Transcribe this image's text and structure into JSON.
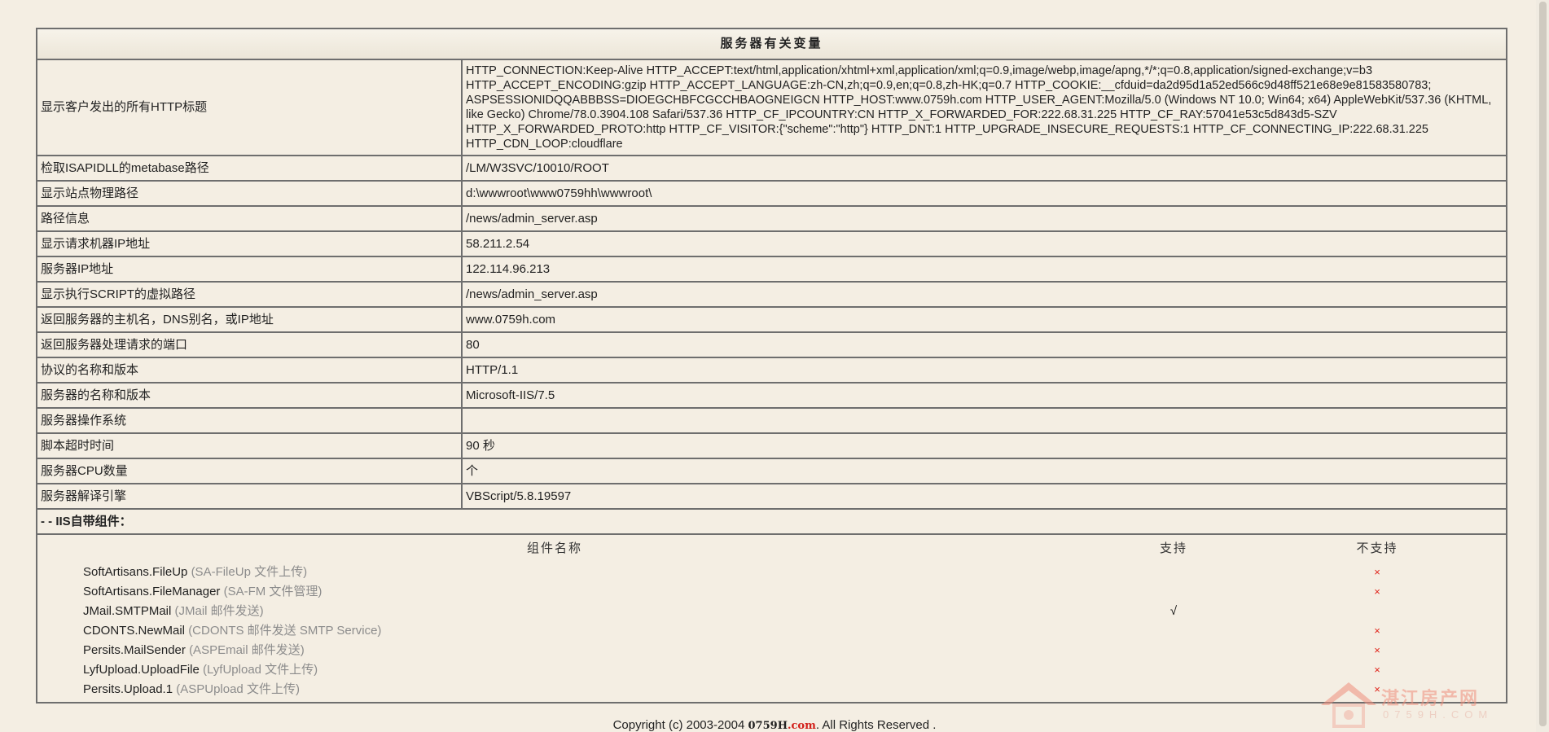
{
  "title": "服务器有关变量",
  "rows": [
    {
      "label": "显示客户发出的所有HTTP标题",
      "value": "HTTP_CONNECTION:Keep-Alive HTTP_ACCEPT:text/html,application/xhtml+xml,application/xml;q=0.9,image/webp,image/apng,*/*;q=0.8,application/signed-exchange;v=b3 HTTP_ACCEPT_ENCODING:gzip HTTP_ACCEPT_LANGUAGE:zh-CN,zh;q=0.9,en;q=0.8,zh-HK;q=0.7 HTTP_COOKIE:__cfduid=da2d95d1a52ed566c9d48ff521e68e9e81583580783; ASPSESSIONIDQQABBBSS=DIOEGCHBFCGCCHBAOGNEIGCN HTTP_HOST:www.0759h.com HTTP_USER_AGENT:Mozilla/5.0 (Windows NT 10.0; Win64; x64) AppleWebKit/537.36 (KHTML, like Gecko) Chrome/78.0.3904.108 Safari/537.36 HTTP_CF_IPCOUNTRY:CN HTTP_X_FORWARDED_FOR:222.68.31.225 HTTP_CF_RAY:57041e53c5d843d5-SZV HTTP_X_FORWARDED_PROTO:http HTTP_CF_VISITOR:{\"scheme\":\"http\"} HTTP_DNT:1 HTTP_UPGRADE_INSECURE_REQUESTS:1 HTTP_CF_CONNECTING_IP:222.68.31.225 HTTP_CDN_LOOP:cloudflare"
    },
    {
      "label": "检取ISAPIDLL的metabase路径",
      "value": "/LM/W3SVC/10010/ROOT"
    },
    {
      "label": "显示站点物理路径",
      "value": "d:\\wwwroot\\www0759hh\\wwwroot\\"
    },
    {
      "label": "路径信息",
      "value": "/news/admin_server.asp"
    },
    {
      "label": "显示请求机器IP地址",
      "value": "58.211.2.54"
    },
    {
      "label": "服务器IP地址",
      "value": "122.114.96.213"
    },
    {
      "label": "显示执行SCRIPT的虚拟路径",
      "value": "/news/admin_server.asp"
    },
    {
      "label": "返回服务器的主机名，DNS别名，或IP地址",
      "value": "www.0759h.com"
    },
    {
      "label": "返回服务器处理请求的端口",
      "value": "80"
    },
    {
      "label": "协议的名称和版本",
      "value": "HTTP/1.1"
    },
    {
      "label": "服务器的名称和版本",
      "value": "Microsoft-IIS/7.5"
    },
    {
      "label": "服务器操作系统",
      "value": ""
    },
    {
      "label": "脚本超时时间",
      "value": "90 秒"
    },
    {
      "label": "服务器CPU数量",
      "value": "个"
    },
    {
      "label": "服务器解译引擎",
      "value": "VBScript/5.8.19597"
    }
  ],
  "components": {
    "section_title": "- - IIS自带组件：",
    "col_name": "组件名称",
    "col_yes": "支持",
    "col_no": "不支持",
    "items": [
      {
        "name": "SoftArtisans.FileUp",
        "desc": "(SA-FileUp 文件上传)",
        "yes": "",
        "no": "×"
      },
      {
        "name": "SoftArtisans.FileManager",
        "desc": "(SA-FM 文件管理)",
        "yes": "",
        "no": "×"
      },
      {
        "name": "JMail.SMTPMail",
        "desc": "(JMail 邮件发送)",
        "yes": "√",
        "no": ""
      },
      {
        "name": "CDONTS.NewMail",
        "desc": "(CDONTS 邮件发送 SMTP Service)",
        "yes": "",
        "no": "×"
      },
      {
        "name": "Persits.MailSender",
        "desc": "(ASPEmail 邮件发送)",
        "yes": "",
        "no": "×"
      },
      {
        "name": "LyfUpload.UploadFile",
        "desc": "(LyfUpload 文件上传)",
        "yes": "",
        "no": "×"
      },
      {
        "name": "Persits.Upload.1",
        "desc": "(ASPUpload 文件上传)",
        "yes": "",
        "no": "×"
      }
    ]
  },
  "footer": {
    "prefix": "Copyright (c) 2003-2004 ",
    "brand": "0759H",
    "brand_dom": ".com",
    "suffix": ". All Rights Reserved ."
  },
  "watermark": {
    "text": "湛江房产网",
    "sub": "0759H.COM"
  },
  "colors": {
    "background": "#f4eee3",
    "border": "#6e6e6e",
    "unsupported": "#e0241b",
    "description": "#8c8c8c"
  }
}
